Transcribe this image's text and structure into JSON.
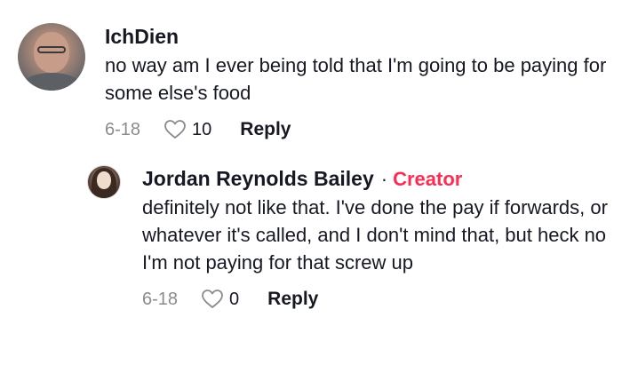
{
  "comments": [
    {
      "username": "IchDien",
      "text": "no way am I ever being told that I'm going to be paying for some else's food",
      "date": "6-18",
      "likes": "10",
      "reply_label": "Reply"
    }
  ],
  "reply": {
    "username": "Jordan Reynolds Bailey",
    "separator": "·",
    "badge": "Creator",
    "text": "definitely not like that. I've done the pay if forwards, or whatever it's called, and I don't mind that, but heck no I'm not paying for that screw up",
    "date": "6-18",
    "likes": "0",
    "reply_label": "Reply"
  },
  "colors": {
    "creator_badge": "#fe2c55",
    "meta_gray": "#8a8b91"
  },
  "icons": {
    "like": "heart-outline-icon"
  }
}
